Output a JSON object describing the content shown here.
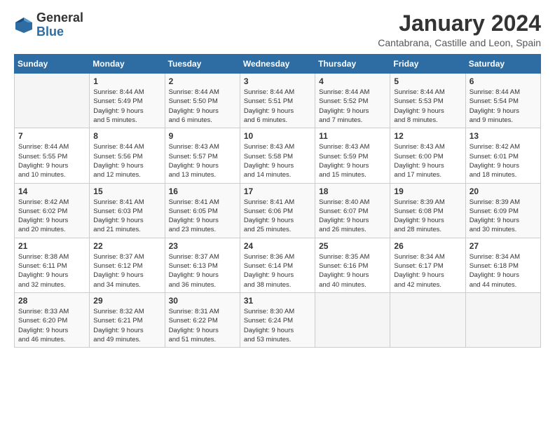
{
  "logo": {
    "general": "General",
    "blue": "Blue"
  },
  "header": {
    "title": "January 2024",
    "subtitle": "Cantabrana, Castille and Leon, Spain"
  },
  "columns": [
    "Sunday",
    "Monday",
    "Tuesday",
    "Wednesday",
    "Thursday",
    "Friday",
    "Saturday"
  ],
  "weeks": [
    [
      {
        "num": "",
        "info": ""
      },
      {
        "num": "1",
        "info": "Sunrise: 8:44 AM\nSunset: 5:49 PM\nDaylight: 9 hours\nand 5 minutes."
      },
      {
        "num": "2",
        "info": "Sunrise: 8:44 AM\nSunset: 5:50 PM\nDaylight: 9 hours\nand 6 minutes."
      },
      {
        "num": "3",
        "info": "Sunrise: 8:44 AM\nSunset: 5:51 PM\nDaylight: 9 hours\nand 6 minutes."
      },
      {
        "num": "4",
        "info": "Sunrise: 8:44 AM\nSunset: 5:52 PM\nDaylight: 9 hours\nand 7 minutes."
      },
      {
        "num": "5",
        "info": "Sunrise: 8:44 AM\nSunset: 5:53 PM\nDaylight: 9 hours\nand 8 minutes."
      },
      {
        "num": "6",
        "info": "Sunrise: 8:44 AM\nSunset: 5:54 PM\nDaylight: 9 hours\nand 9 minutes."
      }
    ],
    [
      {
        "num": "7",
        "info": "Sunrise: 8:44 AM\nSunset: 5:55 PM\nDaylight: 9 hours\nand 10 minutes."
      },
      {
        "num": "8",
        "info": "Sunrise: 8:44 AM\nSunset: 5:56 PM\nDaylight: 9 hours\nand 12 minutes."
      },
      {
        "num": "9",
        "info": "Sunrise: 8:43 AM\nSunset: 5:57 PM\nDaylight: 9 hours\nand 13 minutes."
      },
      {
        "num": "10",
        "info": "Sunrise: 8:43 AM\nSunset: 5:58 PM\nDaylight: 9 hours\nand 14 minutes."
      },
      {
        "num": "11",
        "info": "Sunrise: 8:43 AM\nSunset: 5:59 PM\nDaylight: 9 hours\nand 15 minutes."
      },
      {
        "num": "12",
        "info": "Sunrise: 8:43 AM\nSunset: 6:00 PM\nDaylight: 9 hours\nand 17 minutes."
      },
      {
        "num": "13",
        "info": "Sunrise: 8:42 AM\nSunset: 6:01 PM\nDaylight: 9 hours\nand 18 minutes."
      }
    ],
    [
      {
        "num": "14",
        "info": "Sunrise: 8:42 AM\nSunset: 6:02 PM\nDaylight: 9 hours\nand 20 minutes."
      },
      {
        "num": "15",
        "info": "Sunrise: 8:41 AM\nSunset: 6:03 PM\nDaylight: 9 hours\nand 21 minutes."
      },
      {
        "num": "16",
        "info": "Sunrise: 8:41 AM\nSunset: 6:05 PM\nDaylight: 9 hours\nand 23 minutes."
      },
      {
        "num": "17",
        "info": "Sunrise: 8:41 AM\nSunset: 6:06 PM\nDaylight: 9 hours\nand 25 minutes."
      },
      {
        "num": "18",
        "info": "Sunrise: 8:40 AM\nSunset: 6:07 PM\nDaylight: 9 hours\nand 26 minutes."
      },
      {
        "num": "19",
        "info": "Sunrise: 8:39 AM\nSunset: 6:08 PM\nDaylight: 9 hours\nand 28 minutes."
      },
      {
        "num": "20",
        "info": "Sunrise: 8:39 AM\nSunset: 6:09 PM\nDaylight: 9 hours\nand 30 minutes."
      }
    ],
    [
      {
        "num": "21",
        "info": "Sunrise: 8:38 AM\nSunset: 6:11 PM\nDaylight: 9 hours\nand 32 minutes."
      },
      {
        "num": "22",
        "info": "Sunrise: 8:37 AM\nSunset: 6:12 PM\nDaylight: 9 hours\nand 34 minutes."
      },
      {
        "num": "23",
        "info": "Sunrise: 8:37 AM\nSunset: 6:13 PM\nDaylight: 9 hours\nand 36 minutes."
      },
      {
        "num": "24",
        "info": "Sunrise: 8:36 AM\nSunset: 6:14 PM\nDaylight: 9 hours\nand 38 minutes."
      },
      {
        "num": "25",
        "info": "Sunrise: 8:35 AM\nSunset: 6:16 PM\nDaylight: 9 hours\nand 40 minutes."
      },
      {
        "num": "26",
        "info": "Sunrise: 8:34 AM\nSunset: 6:17 PM\nDaylight: 9 hours\nand 42 minutes."
      },
      {
        "num": "27",
        "info": "Sunrise: 8:34 AM\nSunset: 6:18 PM\nDaylight: 9 hours\nand 44 minutes."
      }
    ],
    [
      {
        "num": "28",
        "info": "Sunrise: 8:33 AM\nSunset: 6:20 PM\nDaylight: 9 hours\nand 46 minutes."
      },
      {
        "num": "29",
        "info": "Sunrise: 8:32 AM\nSunset: 6:21 PM\nDaylight: 9 hours\nand 49 minutes."
      },
      {
        "num": "30",
        "info": "Sunrise: 8:31 AM\nSunset: 6:22 PM\nDaylight: 9 hours\nand 51 minutes."
      },
      {
        "num": "31",
        "info": "Sunrise: 8:30 AM\nSunset: 6:24 PM\nDaylight: 9 hours\nand 53 minutes."
      },
      {
        "num": "",
        "info": ""
      },
      {
        "num": "",
        "info": ""
      },
      {
        "num": "",
        "info": ""
      }
    ]
  ]
}
